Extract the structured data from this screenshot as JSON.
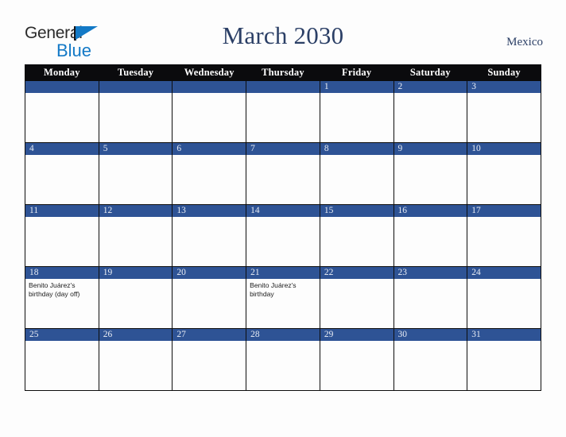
{
  "brand": {
    "name_top": "General",
    "name_bottom": "Blue",
    "top_color": "#2b2b2b",
    "bottom_color": "#1379c6",
    "triangle_icon": "triangle-icon"
  },
  "header": {
    "title": "March 2030",
    "region": "Mexico",
    "title_color": "#2b3f66"
  },
  "calendar": {
    "month": "March",
    "year": "2030",
    "country": "Mexico",
    "header_bg": "#0b0b0d",
    "daybar_bg": "#2e5395",
    "cell_bg": "#fdfdfd",
    "weekdays": [
      "Monday",
      "Tuesday",
      "Wednesday",
      "Thursday",
      "Friday",
      "Saturday",
      "Sunday"
    ],
    "weeks": [
      [
        {
          "date": "",
          "events": []
        },
        {
          "date": "",
          "events": []
        },
        {
          "date": "",
          "events": []
        },
        {
          "date": "",
          "events": []
        },
        {
          "date": "1",
          "events": []
        },
        {
          "date": "2",
          "events": []
        },
        {
          "date": "3",
          "events": []
        }
      ],
      [
        {
          "date": "4",
          "events": []
        },
        {
          "date": "5",
          "events": []
        },
        {
          "date": "6",
          "events": []
        },
        {
          "date": "7",
          "events": []
        },
        {
          "date": "8",
          "events": []
        },
        {
          "date": "9",
          "events": []
        },
        {
          "date": "10",
          "events": []
        }
      ],
      [
        {
          "date": "11",
          "events": []
        },
        {
          "date": "12",
          "events": []
        },
        {
          "date": "13",
          "events": []
        },
        {
          "date": "14",
          "events": []
        },
        {
          "date": "15",
          "events": []
        },
        {
          "date": "16",
          "events": []
        },
        {
          "date": "17",
          "events": []
        }
      ],
      [
        {
          "date": "18",
          "events": [
            "Benito Juárez's birthday (day off)"
          ]
        },
        {
          "date": "19",
          "events": []
        },
        {
          "date": "20",
          "events": []
        },
        {
          "date": "21",
          "events": [
            "Benito Juárez's birthday"
          ]
        },
        {
          "date": "22",
          "events": []
        },
        {
          "date": "23",
          "events": []
        },
        {
          "date": "24",
          "events": []
        }
      ],
      [
        {
          "date": "25",
          "events": []
        },
        {
          "date": "26",
          "events": []
        },
        {
          "date": "27",
          "events": []
        },
        {
          "date": "28",
          "events": []
        },
        {
          "date": "29",
          "events": []
        },
        {
          "date": "30",
          "events": []
        },
        {
          "date": "31",
          "events": []
        }
      ]
    ]
  }
}
